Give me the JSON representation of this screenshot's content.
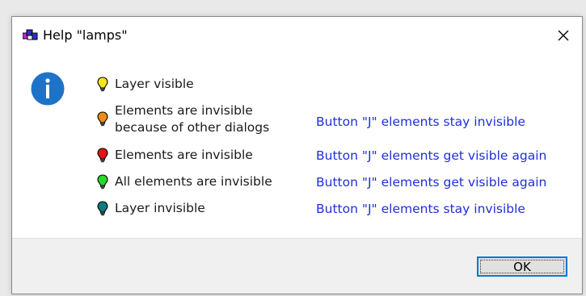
{
  "window": {
    "title": "Help \"lamps\"",
    "close_label": "×"
  },
  "icons": {
    "app": "dialog-app-icon",
    "info": "info-icon",
    "close": "close-icon"
  },
  "rows": [
    {
      "lamp_color": "#f5e61d",
      "label_line1": "Layer visible",
      "label_line2": "",
      "action": ""
    },
    {
      "lamp_color": "#f08b1e",
      "label_line1": "Elements are invisible",
      "label_line2": "because of other dialogs",
      "action": "Button \"J\"  elements stay invisible"
    },
    {
      "lamp_color": "#e01818",
      "label_line1": "Elements are invisible",
      "label_line2": "",
      "action": "Button \"J\"  elements get visible again"
    },
    {
      "lamp_color": "#29d82a",
      "label_line1": "All elements are invisible",
      "label_line2": "",
      "action": "Button \"J\"  elements get visible again"
    },
    {
      "lamp_color": "#0f7a7f",
      "label_line1": "Layer invisible",
      "label_line2": "",
      "action": "Button \"J\"  elements stay invisible"
    }
  ],
  "footer": {
    "ok_label": "OK"
  },
  "colors": {
    "info_blue": "#1e73c8",
    "link_blue": "#1f2fd6",
    "accent_border": "#0078d7"
  }
}
